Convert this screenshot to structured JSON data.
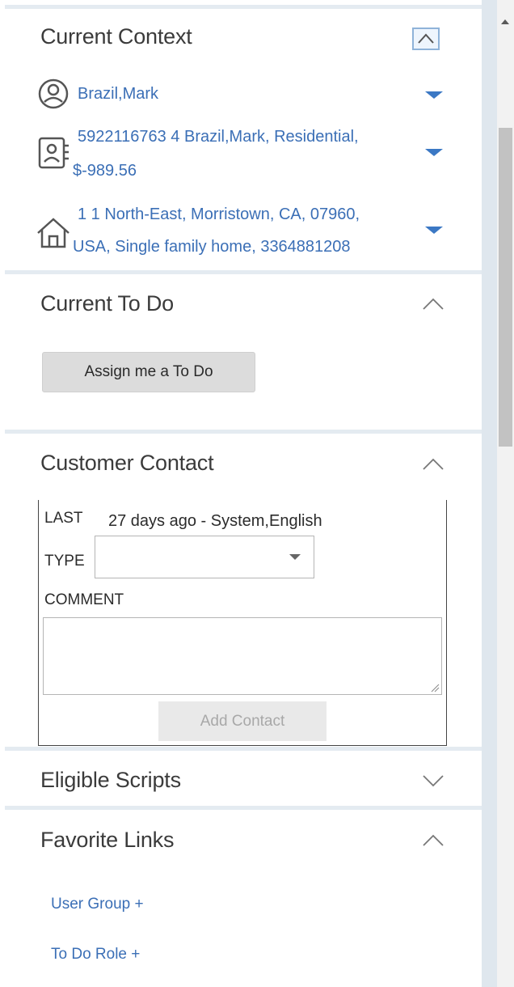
{
  "current_context": {
    "title": "Current Context",
    "person": "Brazil,Mark",
    "account_line1": "5922116763 4 Brazil,Mark, Residential,",
    "account_line2": "$-989.56",
    "address_line1": "1 1 North-East, Morristown, CA, 07960,",
    "address_line2": "USA, Single family home, 3364881208"
  },
  "current_todo": {
    "title": "Current To Do",
    "assign_button": "Assign me a To Do"
  },
  "customer_contact": {
    "title": "Customer Contact",
    "last_label": "LAST",
    "last_value": "27 days ago - System,English",
    "type_label": "TYPE",
    "type_value": "",
    "comment_label": "COMMENT",
    "comment_value": "",
    "add_button": "Add Contact"
  },
  "eligible_scripts": {
    "title": "Eligible Scripts"
  },
  "favorite_links": {
    "title": "Favorite Links",
    "links": [
      "User Group +",
      "To Do Role +"
    ]
  },
  "colors": {
    "link": "#3b6fb6",
    "accent_triangle": "#3b78c4",
    "separator": "#e4ebf1"
  },
  "icons": [
    "person-icon",
    "contact-card-icon",
    "home-icon"
  ]
}
